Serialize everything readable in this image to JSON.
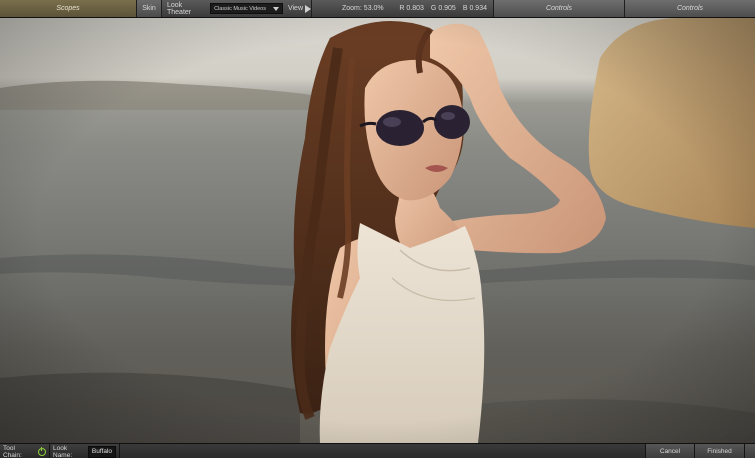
{
  "toolbar": {
    "scopes_label": "Scopes",
    "skin_label": "Skin",
    "look_theater_label": "Look Theater",
    "look_theater_value": "Classic Music Videos",
    "view_label": "View",
    "zoom_label": "Zoom:",
    "zoom_value": "53.0%",
    "r_label": "R",
    "r_value": "0.803",
    "g_label": "G",
    "g_value": "0.905",
    "b_label": "B",
    "b_value": "0.934",
    "controls_label_1": "Controls",
    "controls_label_2": "Controls"
  },
  "bottombar": {
    "tool_chain_label": "Tool Chain:",
    "look_name_label": "Look Name:",
    "look_name_value": "Buffalo",
    "cancel_label": "Cancel",
    "finished_label": "Finished"
  },
  "viewport": {
    "image": "woman-with-sunglasses-on-beach-photo"
  },
  "colors": {
    "scopes_tab": "#6e6444",
    "power_icon": "#8fcf3a",
    "toolbar": "#4a4a4a"
  }
}
